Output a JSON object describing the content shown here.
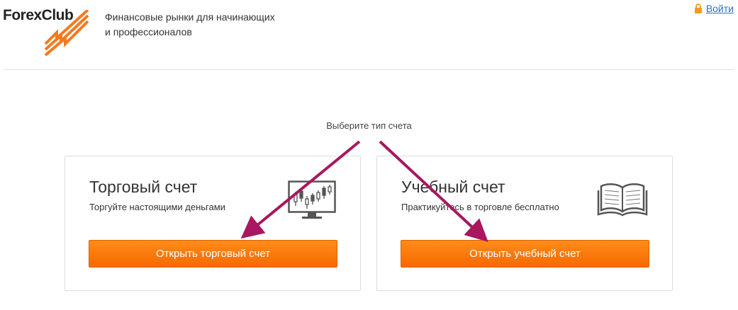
{
  "header": {
    "logo_text": "ForexClub",
    "tagline_line1": "Финансовые рынки для начинающих",
    "tagline_line2": "и профессионалов",
    "login_label": "Войти"
  },
  "main": {
    "prompt": "Выберите тип счета",
    "cards": [
      {
        "title": "Торговый счет",
        "subtitle": "Торгуйте настоящими деньгами",
        "button_label": "Открыть торговый счет",
        "icon": "chart-monitor-icon"
      },
      {
        "title": "Учебный счет",
        "subtitle": "Практикуйтесь в торговле бесплатно",
        "button_label": "Открыть учебный счет",
        "icon": "book-icon"
      }
    ]
  },
  "colors": {
    "accent_orange": "#f97a0f",
    "arrow_magenta": "#a8175f",
    "link_blue": "#2a6fc9"
  }
}
